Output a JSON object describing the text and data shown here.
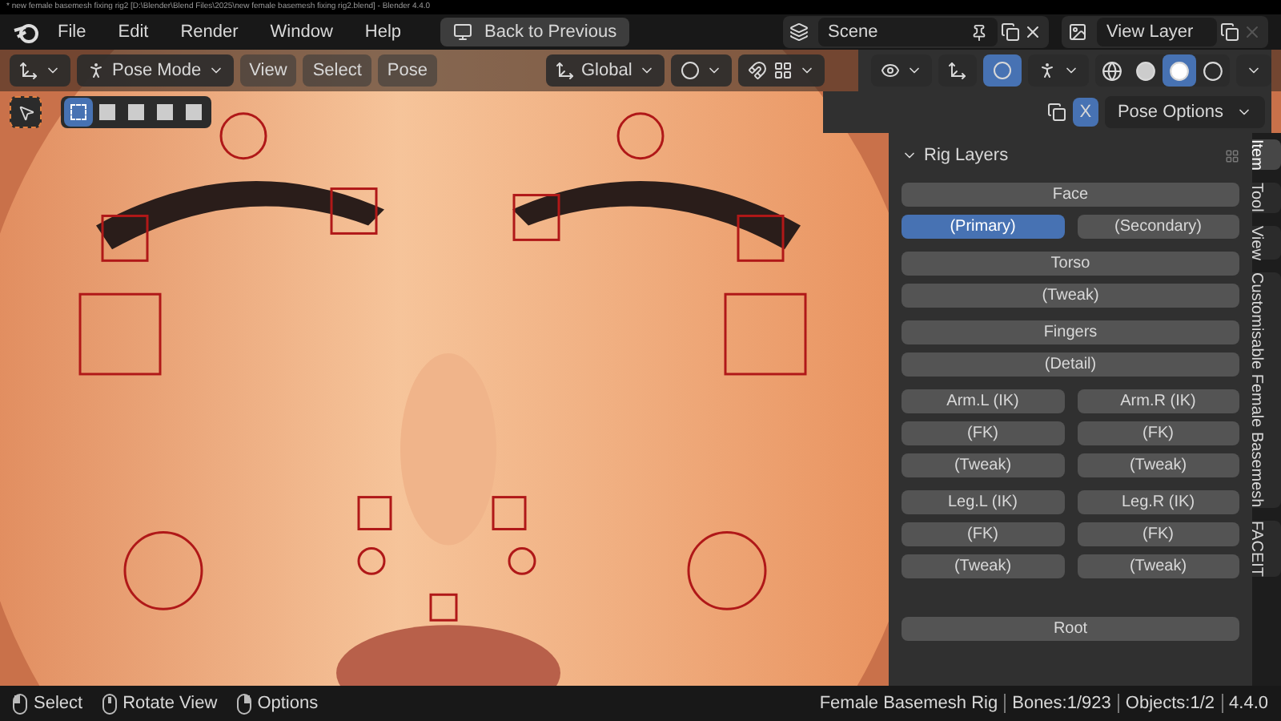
{
  "title_bar": {
    "text": "* new female basemesh fixing rig2 [D:\\Blender\\Blend Files\\2025\\new female basemesh fixing rig2.blend] - Blender 4.4.0"
  },
  "menu": [
    "File",
    "Edit",
    "Render",
    "Window",
    "Help"
  ],
  "back_button": "Back to Previous",
  "scene": {
    "value": "Scene"
  },
  "view_layer": {
    "value": "View Layer"
  },
  "viewport_header": {
    "mode": "Pose Mode",
    "menus": [
      "View",
      "Select",
      "Pose"
    ],
    "orientation": "Global",
    "pose_options": "Pose Options",
    "mirror_x": {
      "label": "X",
      "on": true
    },
    "select_modes": [
      {
        "selected": true
      },
      {
        "selected": false
      },
      {
        "selected": false
      },
      {
        "selected": false
      },
      {
        "selected": false
      }
    ],
    "shading": [
      {
        "kind": "wireframe",
        "selected": false
      },
      {
        "kind": "solid",
        "selected": false
      },
      {
        "kind": "material",
        "selected": true
      },
      {
        "kind": "rendered",
        "selected": false
      }
    ]
  },
  "sidebar": {
    "panel": {
      "title": "Rig Layers",
      "expanded": true,
      "groups": [
        [
          [
            {
              "label": "Face",
              "selected": false
            }
          ],
          [
            {
              "label": "(Primary)",
              "selected": true
            },
            {
              "label": "(Secondary)",
              "selected": false
            }
          ]
        ],
        [
          [
            {
              "label": "Torso",
              "selected": false
            }
          ],
          [
            {
              "label": "(Tweak)",
              "selected": false
            }
          ]
        ],
        [
          [
            {
              "label": "Fingers",
              "selected": false
            }
          ],
          [
            {
              "label": "(Detail)",
              "selected": false
            }
          ]
        ],
        [
          [
            {
              "label": "Arm.L (IK)",
              "selected": false
            },
            {
              "label": "Arm.R (IK)",
              "selected": false
            }
          ],
          [
            {
              "label": "(FK)",
              "selected": false
            },
            {
              "label": "(FK)",
              "selected": false
            }
          ],
          [
            {
              "label": "(Tweak)",
              "selected": false
            },
            {
              "label": "(Tweak)",
              "selected": false
            }
          ]
        ],
        [
          [
            {
              "label": "Leg.L (IK)",
              "selected": false
            },
            {
              "label": "Leg.R (IK)",
              "selected": false
            }
          ],
          [
            {
              "label": "(FK)",
              "selected": false
            },
            {
              "label": "(FK)",
              "selected": false
            }
          ],
          [
            {
              "label": "(Tweak)",
              "selected": false
            },
            {
              "label": "(Tweak)",
              "selected": false
            }
          ]
        ],
        [
          [
            {
              "label": "Root",
              "selected": false
            }
          ]
        ]
      ]
    },
    "tabs": [
      {
        "label": "Item",
        "selected": true
      },
      {
        "label": "Tool",
        "selected": false
      },
      {
        "label": "View",
        "selected": false
      },
      {
        "label": "Customisable Female Basemesh",
        "selected": false
      },
      {
        "label": "FACEIT",
        "selected": false
      }
    ]
  },
  "status_bar": {
    "hints": [
      {
        "kind": "left",
        "label": "Select"
      },
      {
        "kind": "middle",
        "label": "Rotate View"
      },
      {
        "kind": "right",
        "label": "Options"
      }
    ],
    "stats": [
      "Female Basemesh Rig",
      "Bones:1/923",
      "Objects:1/2",
      "4.4.0"
    ]
  }
}
